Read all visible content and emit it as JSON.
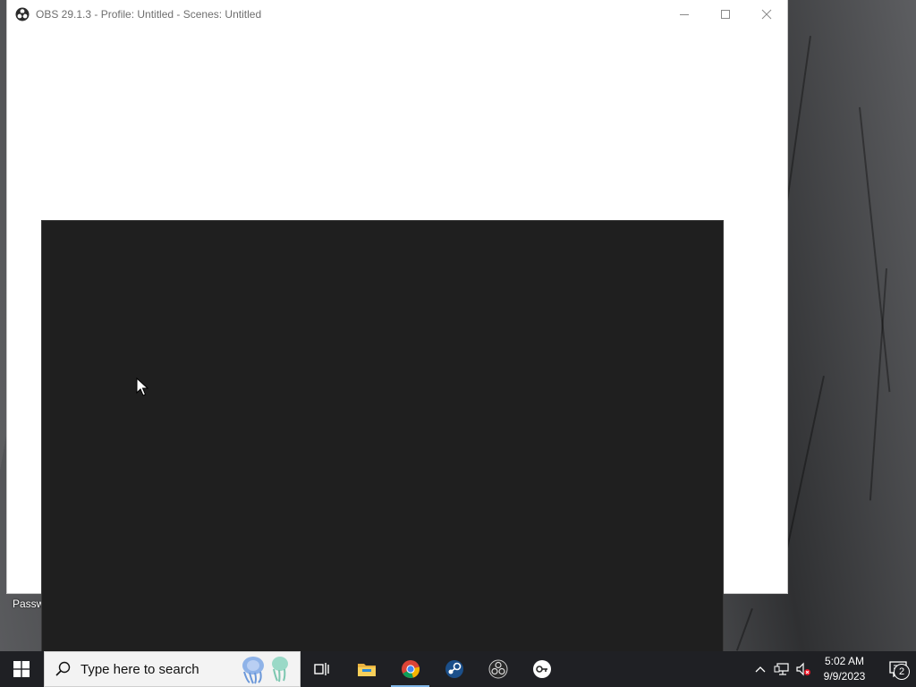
{
  "window": {
    "title": "OBS 29.1.3 - Profile: Untitled - Scenes: Untitled",
    "controls": [
      "minimize",
      "maximize",
      "close"
    ]
  },
  "desktop": {
    "partial_icon_label": "Passw"
  },
  "taskbar": {
    "search_placeholder": "Type here to search",
    "pinned_apps": [
      "task-view",
      "file-explorer",
      "chrome",
      "steam",
      "obs-studio",
      "tool-app"
    ],
    "active_app": "chrome",
    "clock_time": "5:02 AM",
    "clock_date": "9/9/2023",
    "notification_count": "2"
  },
  "colors": {
    "taskbar_bg": "#1f2024",
    "dialog_bg": "#1f1f1f",
    "active_indicator": "#7fb4e6"
  }
}
